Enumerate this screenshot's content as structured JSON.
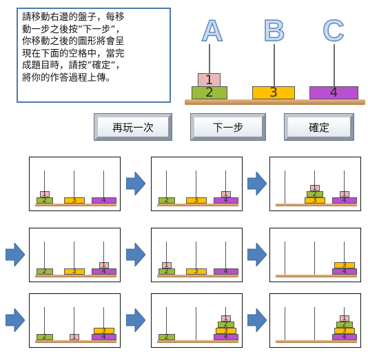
{
  "instructions": "請移動右邊的盤子，每移\n動一步之後按”下一步”，\n你移動之後的圖形將會呈\n現在下面的空格中，當完\n成題目時，請按”確定”，\n將你的作答過程上傳。",
  "pegs": [
    "A",
    "B",
    "C"
  ],
  "buttons": {
    "replay": "再玩一次",
    "next": "下一步",
    "confirm": "確定"
  },
  "disk_colors": {
    "1": "#e8b8b8",
    "2": "#9bbb3a",
    "3": "#ffc000",
    "4": "#b94fd1"
  },
  "current_state": [
    [
      1,
      2
    ],
    [
      3
    ],
    [
      4
    ]
  ],
  "history": [
    [
      [
        1,
        2
      ],
      [
        3
      ],
      [
        4
      ]
    ],
    [
      [
        2
      ],
      [
        3
      ],
      [
        1,
        4
      ]
    ],
    [
      [],
      [
        1,
        2,
        3
      ],
      [
        1,
        4
      ]
    ],
    [
      [
        2
      ],
      [
        3
      ],
      [
        1,
        4
      ]
    ],
    [
      [
        1,
        2
      ],
      [
        3
      ],
      [
        4
      ]
    ],
    [
      [],
      [],
      [
        3,
        4
      ]
    ],
    [
      [
        2
      ],
      [
        1
      ],
      [
        3,
        4
      ]
    ],
    [
      [
        2
      ],
      [],
      [
        1,
        2,
        3,
        4
      ]
    ],
    [
      [],
      [],
      [
        1,
        2,
        3,
        4
      ]
    ]
  ]
}
